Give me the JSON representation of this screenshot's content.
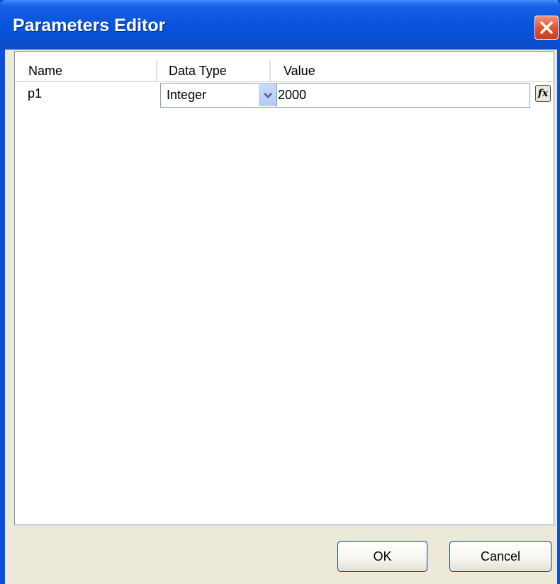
{
  "window": {
    "title": "Parameters Editor",
    "title_bar_color": "#0A55DD",
    "close_icon": "close-icon"
  },
  "grid": {
    "columns": [
      "Name",
      "Data Type",
      "Value"
    ],
    "rows": [
      {
        "name": "p1",
        "data_type": "Integer",
        "value": "2000",
        "expression_button": "fx",
        "dropdown_icon": "chevron-down-icon"
      }
    ]
  },
  "buttons": {
    "ok": "OK",
    "cancel": "Cancel"
  }
}
